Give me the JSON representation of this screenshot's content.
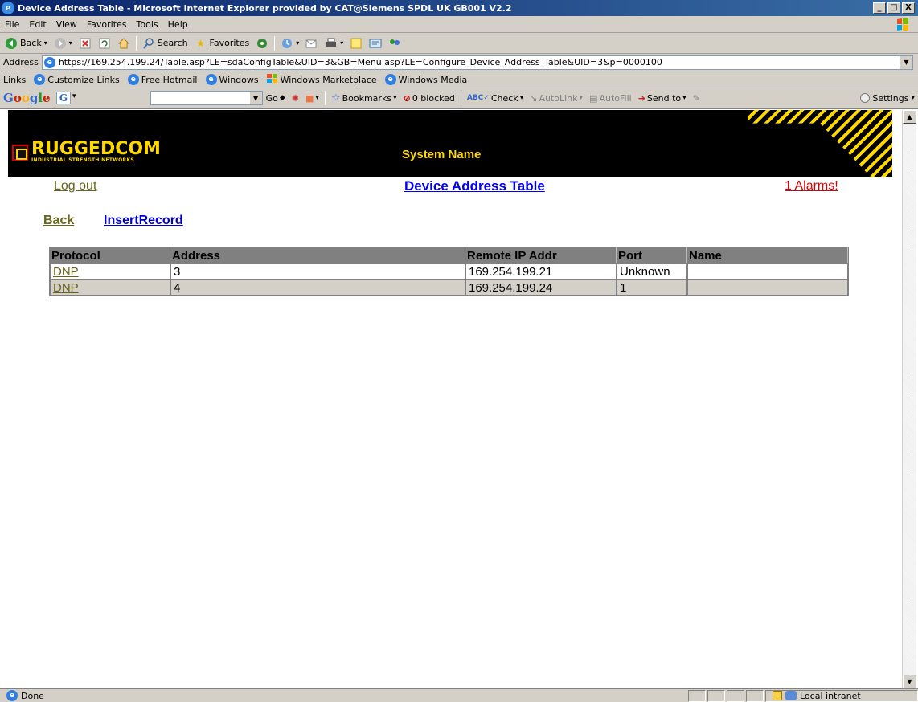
{
  "window": {
    "title": "Device Address Table - Microsoft Internet Explorer provided by CAT@Siemens SPDL UK GB001 V2.2",
    "minimize": "_",
    "maximize": "□",
    "close": "X"
  },
  "menu": {
    "items": [
      {
        "label": "File"
      },
      {
        "label": "Edit"
      },
      {
        "label": "View"
      },
      {
        "label": "Favorites"
      },
      {
        "label": "Tools"
      },
      {
        "label": "Help"
      }
    ]
  },
  "toolbar": {
    "back_label": "Back",
    "search_label": "Search",
    "favorites_label": "Favorites"
  },
  "address": {
    "label": "Address",
    "url": "https://169.254.199.24/Table.asp?LE=sdaConfigTable&UID=3&GB=Menu.asp?LE=Configure_Device_Address_Table&UID=3&p=0000100"
  },
  "links": {
    "label": "Links",
    "items": [
      {
        "label": "Customize Links"
      },
      {
        "label": "Free Hotmail"
      },
      {
        "label": "Windows"
      },
      {
        "label": "Windows Marketplace"
      },
      {
        "label": "Windows Media"
      }
    ]
  },
  "googlebar": {
    "logo": "Google",
    "go_label": "Go",
    "bookmarks_label": "Bookmarks",
    "blocked_label": "0 blocked",
    "check_label": "Check",
    "autolink_label": "AutoLink",
    "autofill_label": "AutoFill",
    "sendto_label": "Send to",
    "settings_label": "Settings"
  },
  "page": {
    "brand": "RUGGEDCOM",
    "brand_sub": "INDUSTRIAL STRENGTH NETWORKS",
    "system_name": "System Name",
    "logout_label": "Log out",
    "title": "Device Address Table",
    "alarms_label": "1 Alarms!",
    "back_label": "Back",
    "insert_label": "InsertRecord",
    "table": {
      "headers": [
        "Protocol",
        "Address",
        "Remote IP Addr",
        "Port",
        "Name"
      ],
      "rows": [
        {
          "protocol": "DNP",
          "address": "3",
          "remote_ip": "169.254.199.21",
          "port": "Unknown",
          "name": ""
        },
        {
          "protocol": "DNP",
          "address": "4",
          "remote_ip": "169.254.199.24",
          "port": "1",
          "name": ""
        }
      ]
    }
  },
  "status": {
    "left": "Done",
    "zone": "Local intranet"
  },
  "colors": {
    "header_bg": "#000000",
    "brand_yellow": "#ffd800",
    "link_olive": "#66651a",
    "alarm_red": "#e00000",
    "title_blue": "#0000ee"
  }
}
